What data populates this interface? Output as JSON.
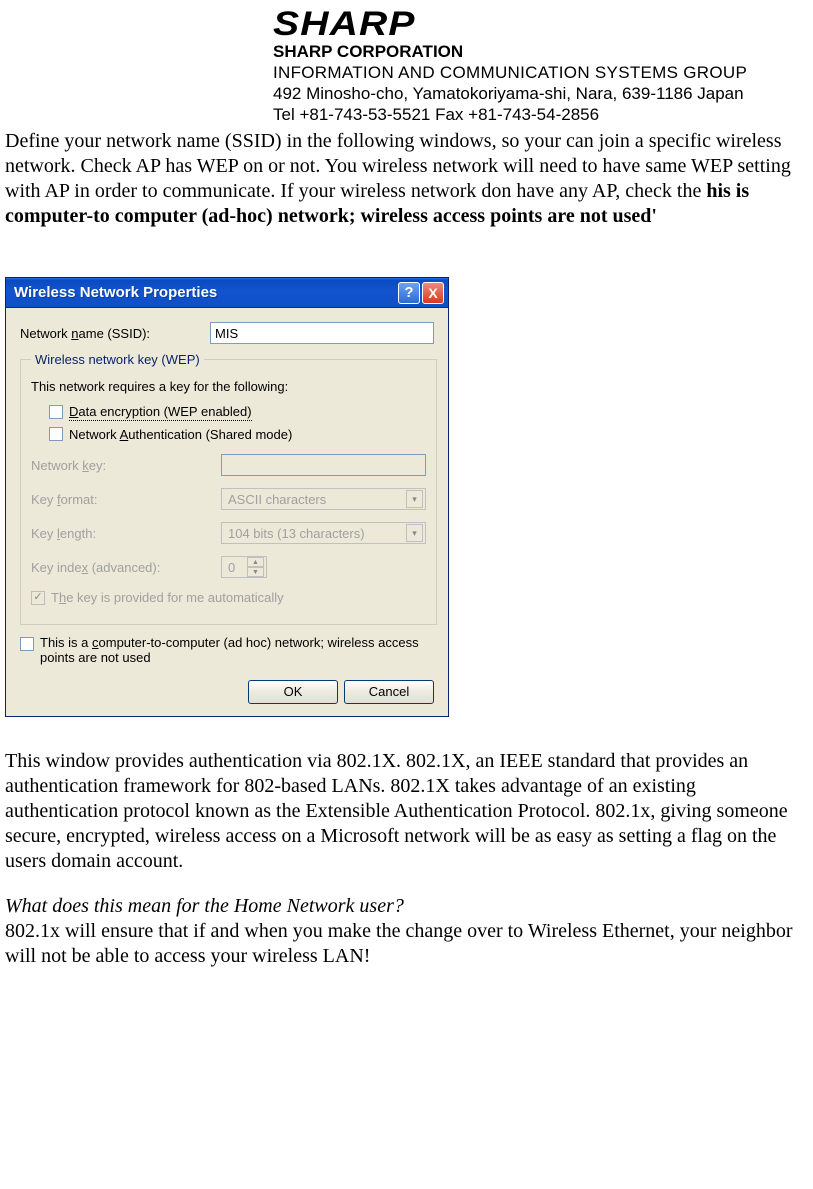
{
  "header": {
    "logo": "SHARP",
    "corp": "SHARP CORPORATION",
    "group": "INFORMATION AND COMMUNICATION SYSTEMS GROUP",
    "addr": "492 Minosho-cho, Yamatokoriyama-shi, Nara, 639-1186 Japan",
    "tel": "Tel +81-743-53-5521 Fax +81-743-54-2856"
  },
  "intro": {
    "text_a": "Define your network name (SSID) in the following windows, so your can join a specific wireless network. Check AP has WEP on or not. You wireless network will need to have same WEP setting with AP in order to communicate. If your wireless network don      have any AP, check the ",
    "bold": "his is computer-to computer (ad-hoc) network; wireless access points are not used'"
  },
  "dialog": {
    "title": "Wireless Network Properties",
    "help": "?",
    "close": "X",
    "ssid_label_pre": "Network ",
    "ssid_label_u": "n",
    "ssid_label_post": "ame (SSID):",
    "ssid_value": "MIS",
    "group_legend": "Wireless network key (WEP)",
    "group_desc": "This network requires a key for the following:",
    "chk_data_pre": "",
    "chk_data_u": "D",
    "chk_data_post": "ata encryption (WEP enabled)",
    "chk_auth_pre": "Network ",
    "chk_auth_u": "A",
    "chk_auth_post": "uthentication (Shared mode)",
    "netkey_label_pre": "Network ",
    "netkey_label_u": "k",
    "netkey_label_post": "ey:",
    "keyformat_label_pre": "Key ",
    "keyformat_label_u": "f",
    "keyformat_label_post": "ormat:",
    "keyformat_value": "ASCII characters",
    "keylen_label_pre": "Key ",
    "keylen_label_u": "l",
    "keylen_label_post": "ength:",
    "keylen_value": "104 bits (13 characters)",
    "keyidx_label_pre": "Key inde",
    "keyidx_label_u": "x",
    "keyidx_label_post": " (advanced):",
    "keyidx_value": "0",
    "auto_label_pre": "T",
    "auto_label_u": "h",
    "auto_label_post": "e key is provided for me automatically",
    "adhoc_label_pre": "This is a ",
    "adhoc_label_u": "c",
    "adhoc_label_post": "omputer-to-computer (ad hoc) network; wireless access points are not used",
    "ok": "OK",
    "cancel": "Cancel"
  },
  "below": {
    "para1": "This window provides authentication via 802.1X. 802.1X, an IEEE standard that provides an authentication framework for 802-based LANs. 802.1X takes advantage of an existing authentication protocol known as the Extensible Authentication Protocol. 802.1x, giving someone secure, encrypted, wireless access on a Microsoft network will be as easy as setting a flag on the users domain account.",
    "question": "What does this mean for the Home Network user?",
    "para2": "802.1x will ensure that if and when you make the change over to Wireless Ethernet, your neighbor will not be able to access your wireless LAN!"
  }
}
